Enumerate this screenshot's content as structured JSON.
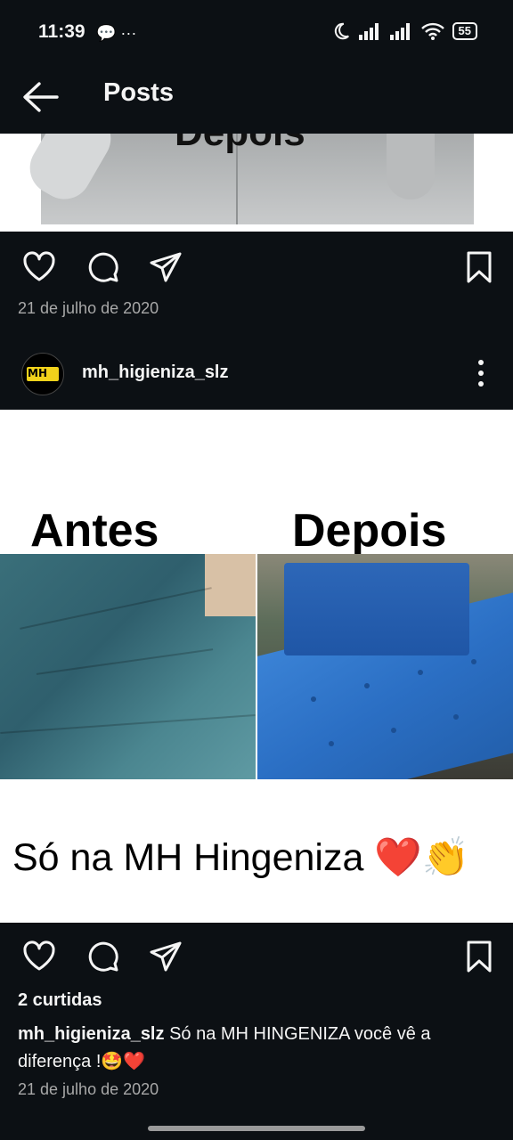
{
  "status_bar": {
    "time": "11:39",
    "left_icons": "💬 ···",
    "battery": "55"
  },
  "header": {
    "title": "Posts"
  },
  "prev_post": {
    "image_text": "Depois",
    "date": "21 de julho de 2020"
  },
  "post": {
    "username": "mh_higieniza_slz",
    "avatar_text": "MH",
    "image": {
      "label_before": "Antes",
      "label_after": "Depois",
      "caption_text": "Só na MH Hingeniza",
      "caption_emoji": "❤️👏"
    },
    "likes": "2 curtidas",
    "caption_user": "mh_higieniza_slz",
    "caption_text": "Só na MH HINGENIZA você vê a diferença !🤩❤️",
    "date": "21 de julho de 2020"
  },
  "icons": [
    "back-arrow-icon",
    "heart-icon",
    "comment-icon",
    "share-icon",
    "bookmark-icon",
    "more-vertical-icon"
  ]
}
